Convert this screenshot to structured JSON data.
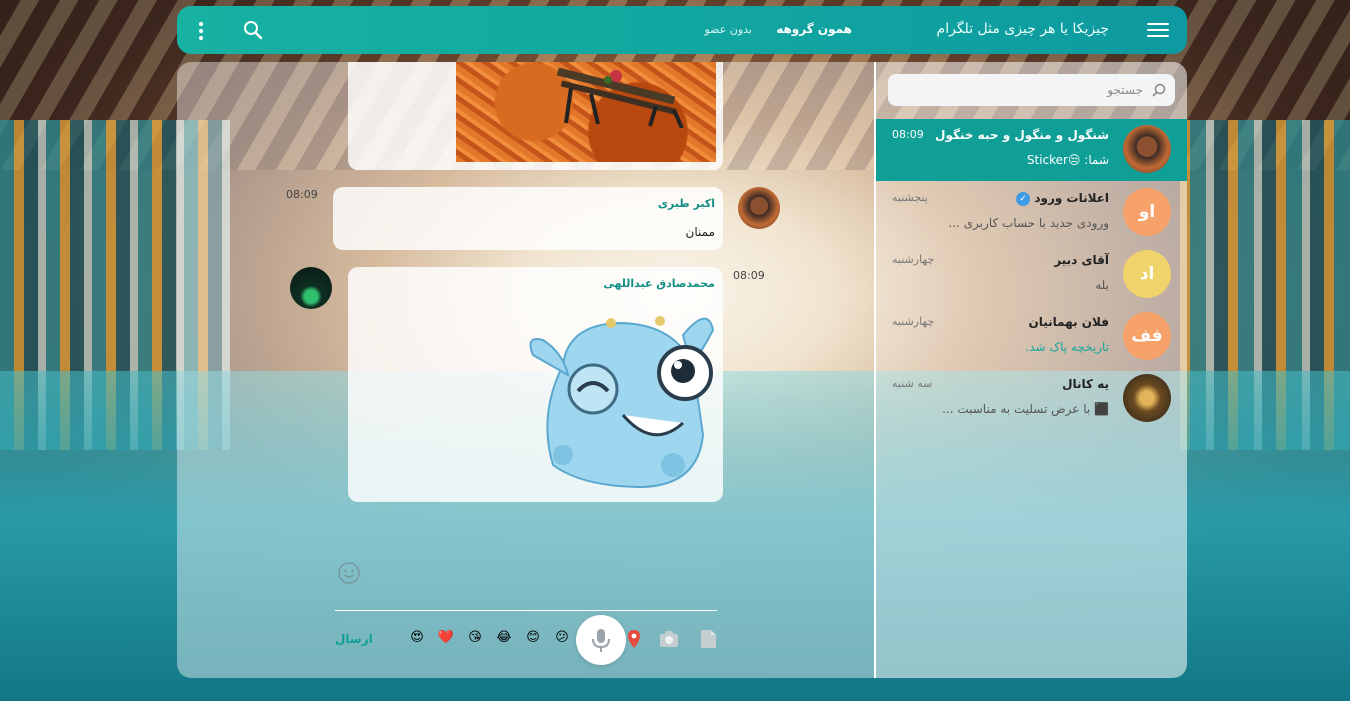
{
  "app": {
    "title": "چیزیکا یا هر چیزی مثل تلگرام"
  },
  "header": {
    "group_name": "همون گروهه",
    "members": "بدون عضو"
  },
  "search": {
    "placeholder": "جستجو"
  },
  "dialogs": [
    {
      "name": "شنگول و منگول و حبه خنگول",
      "last": "شما: 😒Sticker",
      "time": "08:09",
      "active": true,
      "avatar_icon": "profile-photo"
    },
    {
      "name": "اعلانات ورود",
      "verified": true,
      "last": "ورودی جدید با حساب کاربری ...",
      "time": "پنجشنبه",
      "avatar_text": "او",
      "avatar_color": "#f7a26a"
    },
    {
      "name": "آقای دبیر",
      "last": "بله",
      "time": "چهارشنبه",
      "avatar_text": "اد",
      "avatar_color": "#f0d36a"
    },
    {
      "name": "فلان بهمانیان",
      "last": "تاریخچه پاک شد.",
      "time": "چهارشنبه",
      "avatar_text": "فف",
      "avatar_color": "#f7a26a"
    },
    {
      "name": "یه کانال",
      "last": "⬛ با عرض تسلیت به مناسبت ...",
      "time": "سه شنبه",
      "avatar_icon": "channel-photo"
    }
  ],
  "messages": [
    {
      "type": "photo",
      "time": ""
    },
    {
      "type": "text",
      "sender": "اکبر طبری",
      "text": "ممنان",
      "time": "08:09"
    },
    {
      "type": "sticker",
      "sender": "محمدصادق عبداللهی",
      "time": "08:09"
    }
  ],
  "composer": {
    "send_label": "ارسال",
    "emojis": [
      "😍",
      "❤️",
      "😘",
      "😂",
      "😊",
      "😕"
    ]
  },
  "colors": {
    "accent": "#0f9f96",
    "header_start": "#17b2a2"
  }
}
